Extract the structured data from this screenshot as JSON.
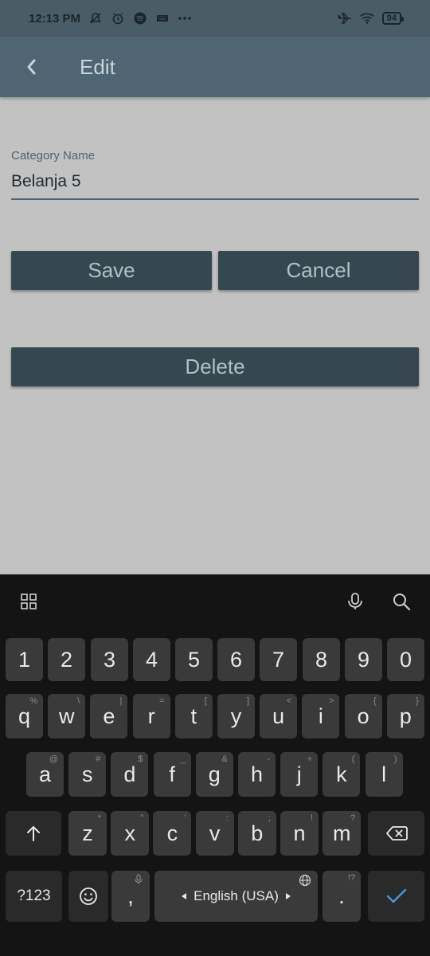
{
  "status_bar": {
    "time": "12:13 PM",
    "battery": "94"
  },
  "app_bar": {
    "title": "Edit"
  },
  "form": {
    "label": "Category Name",
    "value": "Belanja 5"
  },
  "buttons": {
    "save": "Save",
    "cancel": "Cancel",
    "delete": "Delete"
  },
  "keyboard": {
    "numbers": [
      "1",
      "2",
      "3",
      "4",
      "5",
      "6",
      "7",
      "8",
      "9",
      "0"
    ],
    "row1": [
      [
        "q",
        "%"
      ],
      [
        "w",
        "\\"
      ],
      [
        "e",
        "|"
      ],
      [
        "r",
        "="
      ],
      [
        "t",
        "["
      ],
      [
        "y",
        "]"
      ],
      [
        "u",
        "<"
      ],
      [
        "i",
        ">"
      ],
      [
        "o",
        "{"
      ],
      [
        "p",
        "}"
      ]
    ],
    "row2": [
      [
        "a",
        "@"
      ],
      [
        "s",
        "#"
      ],
      [
        "d",
        "$"
      ],
      [
        "f",
        "_"
      ],
      [
        "g",
        "&"
      ],
      [
        "h",
        "-"
      ],
      [
        "j",
        "+"
      ],
      [
        "k",
        "("
      ],
      [
        "l",
        ")"
      ]
    ],
    "row3": [
      [
        "z",
        "*"
      ],
      [
        "x",
        "\""
      ],
      [
        "c",
        "'"
      ],
      [
        "v",
        ":"
      ],
      [
        "b",
        ";"
      ],
      [
        "n",
        "!"
      ],
      [
        "m",
        "?"
      ]
    ],
    "symbols_key": "?123",
    "comma": ",",
    "space_label": "English (USA)",
    "period": ".",
    "period_hint": "!?"
  },
  "colors": {
    "app_bar": "#4f6571",
    "button": "#37474f",
    "background": "#c2c2c2",
    "keyboard": "#141414"
  }
}
